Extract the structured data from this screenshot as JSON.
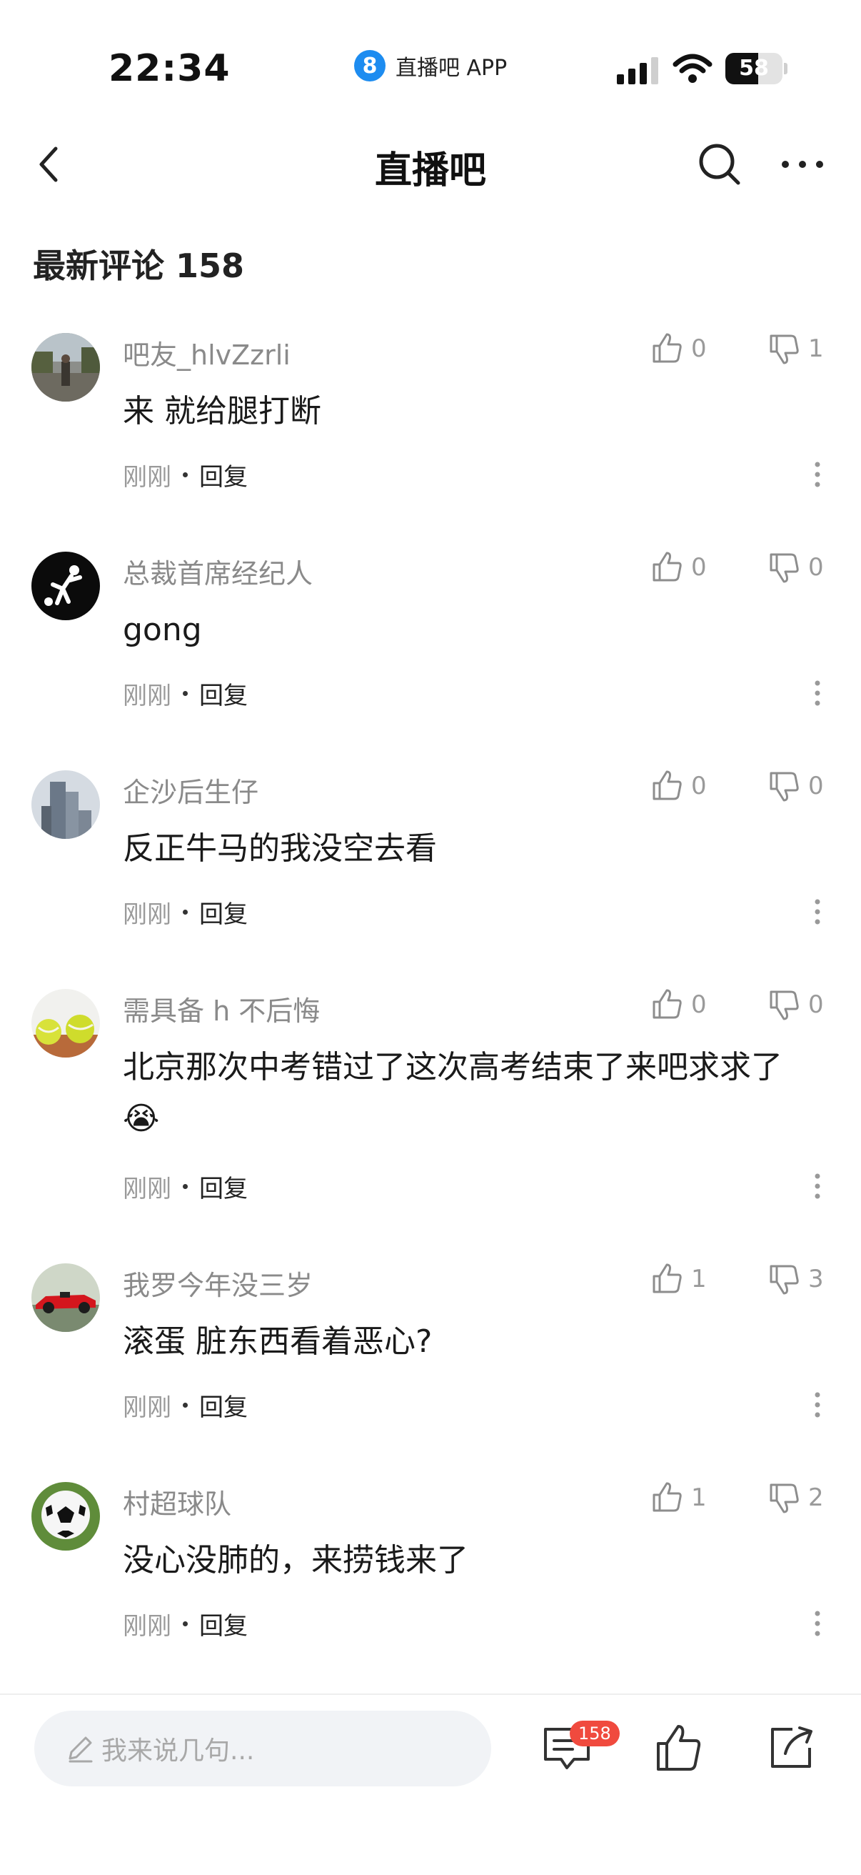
{
  "status_bar": {
    "time": "22:34",
    "app_logo_glyph": "8",
    "app_name": "直播吧 APP",
    "battery_level": "58",
    "icons": [
      "signal-icon",
      "wifi-icon",
      "battery-icon"
    ]
  },
  "nav": {
    "title": "直播吧",
    "icons": [
      "back-icon",
      "search-icon",
      "more-horizontal-icon"
    ]
  },
  "section_title": "最新评论 158",
  "comments": [
    {
      "user": "吧友_hlvZzrli",
      "text": "来 就给腿打断",
      "likes": "0",
      "dislikes": "1",
      "time": "刚刚",
      "reply": "回复",
      "avatar": "photo-person"
    },
    {
      "user": "总裁首席经纪人",
      "text": "gong",
      "likes": "0",
      "dislikes": "0",
      "time": "刚刚",
      "reply": "回复",
      "avatar": "bicycle-kick"
    },
    {
      "user": "企沙后生仔",
      "text": "反正牛马的我没空去看",
      "likes": "0",
      "dislikes": "0",
      "time": "刚刚",
      "reply": "回复",
      "avatar": "skyscraper"
    },
    {
      "user": "需具备 h 不后悔",
      "text": "北京那次中考错过了这次高考结束了来吧求求了😭",
      "likes": "0",
      "dislikes": "0",
      "time": "刚刚",
      "reply": "回复",
      "avatar": "tennis-balls"
    },
    {
      "user": "我罗今年没三岁",
      "text": "滚蛋 脏东西看着恶心?",
      "likes": "1",
      "dislikes": "3",
      "time": "刚刚",
      "reply": "回复",
      "avatar": "race-car"
    },
    {
      "user": "村超球队",
      "text": "没心没肺的，来捞钱来了",
      "likes": "1",
      "dislikes": "2",
      "time": "刚刚",
      "reply": "回复",
      "avatar": "soccer-ball"
    }
  ],
  "bottom_bar": {
    "input_placeholder": "我来说几句...",
    "comment_badge": "158",
    "icons": [
      "pencil-icon",
      "comment-icon",
      "like-icon",
      "share-icon"
    ]
  },
  "colors": {
    "accent_blue": "#1d8cf0",
    "badge_red": "#f04a3e",
    "muted_text": "#8a8a8a"
  }
}
